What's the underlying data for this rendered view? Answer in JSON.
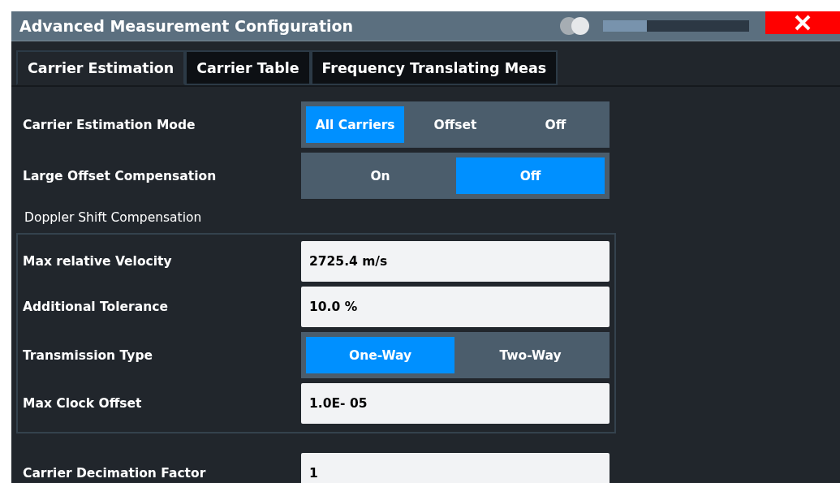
{
  "window": {
    "title": "Advanced Measurement Configuration",
    "transparency": {
      "level": 0.3
    }
  },
  "tabs": [
    {
      "label": "Carrier Estimation",
      "selected": true
    },
    {
      "label": "Carrier Table",
      "selected": false
    },
    {
      "label": "Frequency Translating Meas",
      "selected": false
    }
  ],
  "settings": [
    {
      "kind": "segmented",
      "label": "Carrier Estimation Mode",
      "options": [
        {
          "label": "All Carriers",
          "selected": true
        },
        {
          "label": "Offset",
          "selected": false
        },
        {
          "label": "Off",
          "selected": false
        }
      ]
    },
    {
      "kind": "segmented",
      "label": "Large Offset Compensation",
      "options": [
        {
          "label": "On",
          "selected": false
        },
        {
          "label": "Off",
          "selected": true
        }
      ]
    }
  ],
  "doppler": {
    "title": "Doppler Shift Compensation",
    "settings": [
      {
        "kind": "field",
        "label": "Max relative Velocity",
        "value": "2725.4 m/s"
      },
      {
        "kind": "field",
        "label": "Additional Tolerance",
        "value": "10.0 %"
      },
      {
        "kind": "segmented",
        "label": "Transmission Type",
        "options": [
          {
            "label": "One-Way",
            "selected": true
          },
          {
            "label": "Two-Way",
            "selected": false
          }
        ]
      },
      {
        "kind": "field",
        "label": "Max Clock Offset",
        "value": "1.0E- 05"
      }
    ]
  },
  "footer_settings": [
    {
      "kind": "field",
      "label": "Carrier Decimation Factor",
      "value": "1"
    }
  ]
}
